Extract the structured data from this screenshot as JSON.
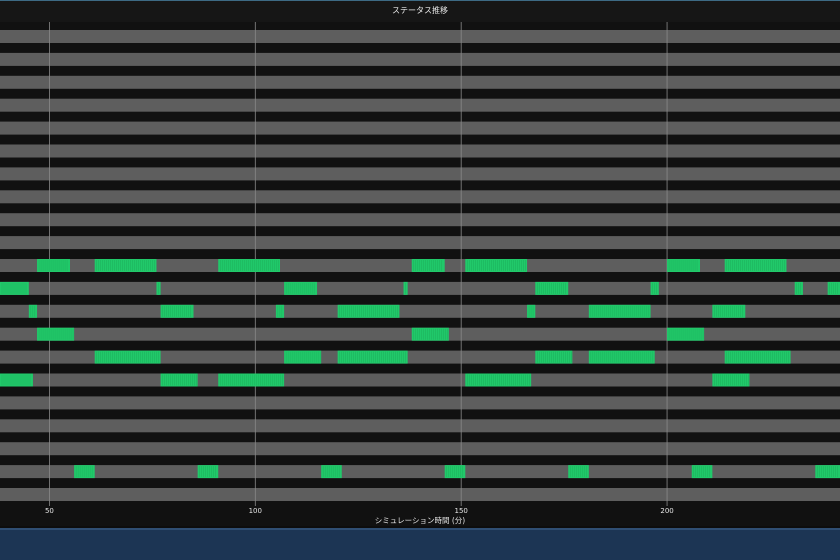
{
  "chart_data": {
    "type": "gantt",
    "title": "ステータス推移",
    "xlabel": "シミュレーション時間 (分)",
    "ylabel": "",
    "xlim": [
      38,
      242
    ],
    "xticks": [
      50,
      100,
      150,
      200
    ],
    "row_count": 21,
    "colors": {
      "background": "#111111",
      "lane": "#5e5e5e",
      "active": "#21c96a",
      "grid": "#8a8a8a",
      "text": "#e6e6e6"
    },
    "rows": [
      [],
      [],
      [],
      [],
      [],
      [],
      [],
      [],
      [],
      [],
      [
        [
          47,
          55
        ],
        [
          61,
          76
        ],
        [
          91,
          106
        ],
        [
          138,
          146
        ],
        [
          151,
          166
        ],
        [
          200,
          208
        ],
        [
          214,
          229
        ]
      ],
      [
        [
          38,
          45
        ],
        [
          76,
          77
        ],
        [
          107,
          115
        ],
        [
          136,
          137
        ],
        [
          168,
          176
        ],
        [
          196,
          198
        ],
        [
          231,
          233
        ],
        [
          239,
          242
        ]
      ],
      [
        [
          45,
          47
        ],
        [
          77,
          85
        ],
        [
          105,
          107
        ],
        [
          120,
          135
        ],
        [
          166,
          168
        ],
        [
          181,
          196
        ],
        [
          211,
          219
        ]
      ],
      [
        [
          47,
          56
        ],
        [
          138,
          147
        ],
        [
          200,
          209
        ]
      ],
      [
        [
          61,
          77
        ],
        [
          107,
          116
        ],
        [
          120,
          137
        ],
        [
          168,
          177
        ],
        [
          181,
          197
        ],
        [
          214,
          230
        ]
      ],
      [
        [
          38,
          46
        ],
        [
          77,
          86
        ],
        [
          91,
          107
        ],
        [
          151,
          167
        ],
        [
          211,
          220
        ]
      ],
      [],
      [],
      [],
      [
        [
          56,
          61
        ],
        [
          86,
          91
        ],
        [
          116,
          121
        ],
        [
          146,
          151
        ],
        [
          176,
          181
        ],
        [
          206,
          211
        ],
        [
          236,
          242
        ]
      ],
      []
    ]
  }
}
